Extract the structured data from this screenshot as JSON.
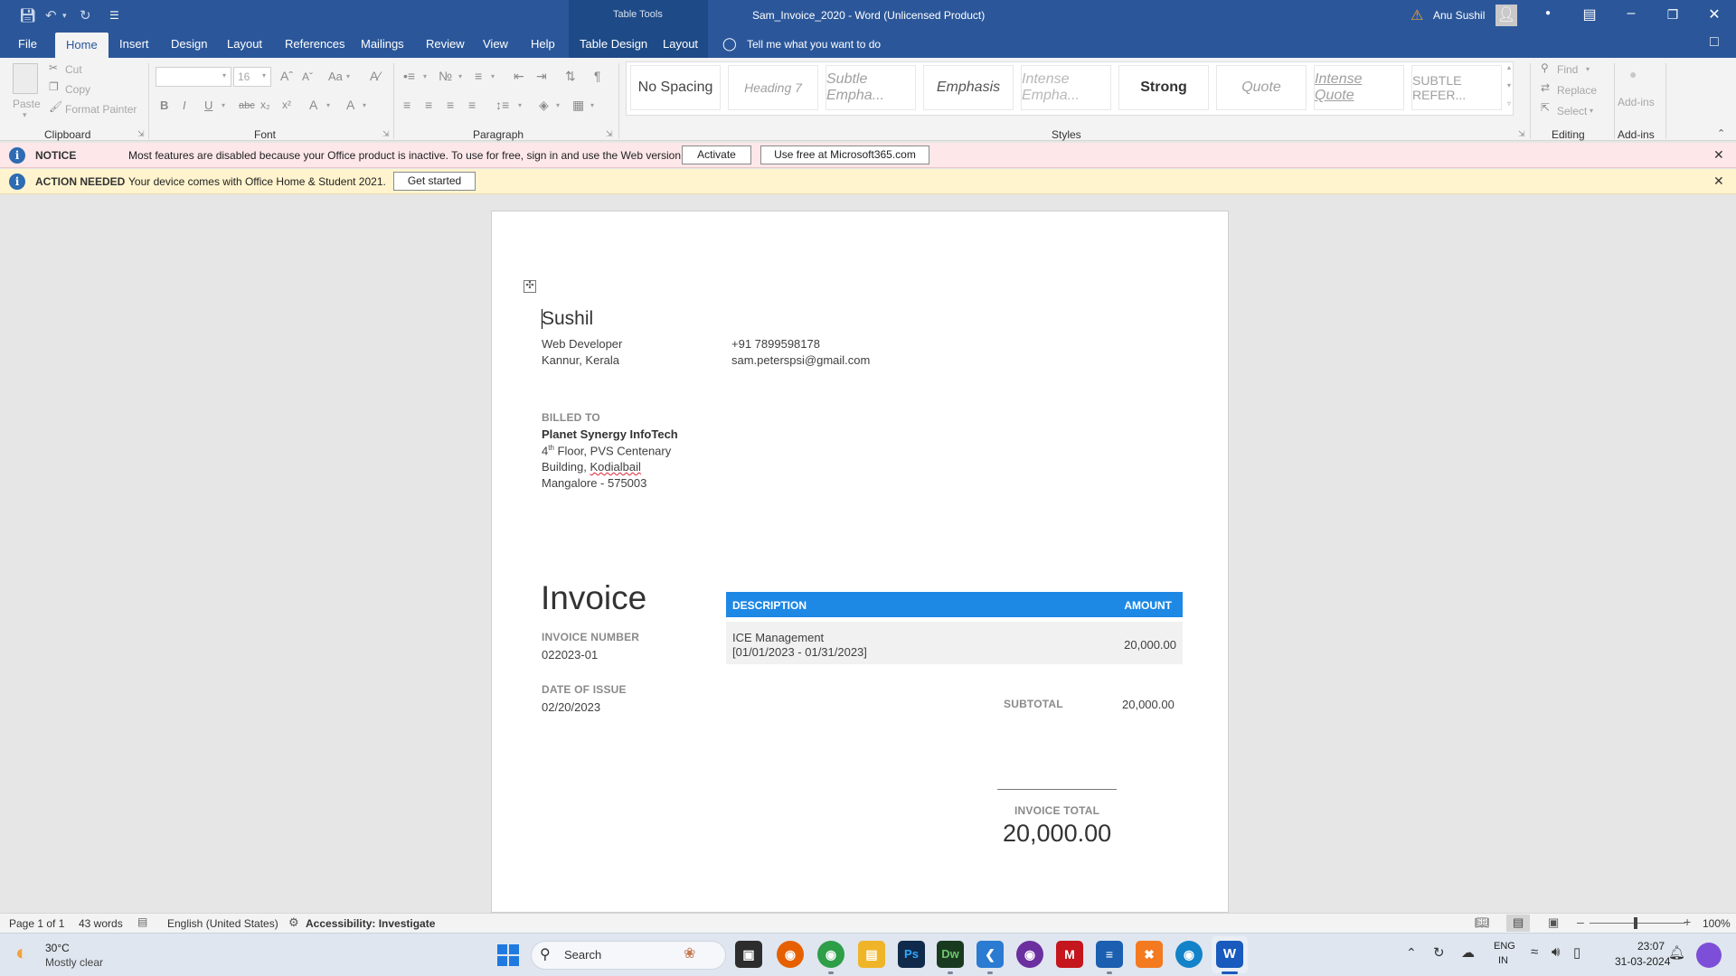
{
  "window": {
    "title": "Sam_Invoice_2020  -  Word (Unlicensed Product)",
    "contextual_title": "Table Tools",
    "user_name": "Anu Sushil"
  },
  "tabs": [
    {
      "label": "File"
    },
    {
      "label": "Home"
    },
    {
      "label": "Insert"
    },
    {
      "label": "Design"
    },
    {
      "label": "Layout"
    },
    {
      "label": "References"
    },
    {
      "label": "Mailings"
    },
    {
      "label": "Review"
    },
    {
      "label": "View"
    },
    {
      "label": "Help"
    },
    {
      "label": "Table Design"
    },
    {
      "label": "Layout"
    }
  ],
  "tell_me": "Tell me what you want to do",
  "ribbon": {
    "clipboard": {
      "label": "Clipboard",
      "paste": "Paste",
      "cut": "Cut",
      "copy": "Copy",
      "format_painter": "Format Painter"
    },
    "font": {
      "label": "Font",
      "size": "16",
      "change_case": "Aa"
    },
    "paragraph": {
      "label": "Paragraph"
    },
    "styles": {
      "label": "Styles",
      "items": [
        "No Spacing",
        "Heading 7",
        "Subtle Empha...",
        "Emphasis",
        "Intense Empha...",
        "Strong",
        "Quote",
        "Intense Quote",
        "SUBTLE REFER..."
      ]
    },
    "editing": {
      "label": "Editing",
      "find": "Find",
      "replace": "Replace",
      "select": "Select"
    },
    "addins": {
      "label": "Add-ins",
      "button": "Add-ins"
    }
  },
  "notice": {
    "title": "NOTICE",
    "text": "Most features are disabled because your Office product is inactive. To use for free, sign in and use the Web version.",
    "activate": "Activate",
    "use_free": "Use free at Microsoft365.com"
  },
  "action": {
    "title": "ACTION NEEDED",
    "text": "Your device comes with Office Home & Student 2021.",
    "button": "Get started"
  },
  "document": {
    "name": "Sushil",
    "role": "Web Developer",
    "location": "Kannur, Kerala",
    "phone": "+91 7899598178",
    "email": "sam.peterspsi@gmail.com",
    "billed_to_label": "BILLED TO",
    "client_name": "Planet Synergy InfoTech",
    "addr_floor_num": "4",
    "addr_floor_sup": "th",
    "addr_line1_rest": " Floor, PVS Centenary",
    "addr_line2_a": "Building, ",
    "addr_line2_b": "Kodialbail",
    "addr_line3": "Mangalore - 575003",
    "invoice_title": "Invoice",
    "invoice_number_label": "INVOICE NUMBER",
    "invoice_number": "022023-01",
    "date_label": "DATE OF ISSUE",
    "date": "02/20/2023",
    "table": {
      "col_description": "DESCRIPTION",
      "col_amount": "AMOUNT",
      "row_desc": "ICE Management",
      "row_period": "[01/01/2023 - 01/31/2023]",
      "row_amount": "20,000.00"
    },
    "subtotal_label": "SUBTOTAL",
    "subtotal": "20,000.00",
    "total_label": "INVOICE TOTAL",
    "total": "20,000.00"
  },
  "status": {
    "page": "Page 1 of 1",
    "words": "43 words",
    "language": "English (United States)",
    "accessibility": "Accessibility: Investigate",
    "zoom": "100%"
  },
  "taskbar": {
    "temperature": "30°C",
    "weather": "Mostly clear",
    "search": "Search",
    "lang_top": "ENG",
    "lang_bottom": "IN",
    "time": "23:07",
    "date": "31-03-2024"
  },
  "colors": {
    "title_bar": "#2b579a",
    "table_header": "#1e88e5",
    "notice_bg": "#fde7e9",
    "action_bg": "#fff4ce"
  }
}
